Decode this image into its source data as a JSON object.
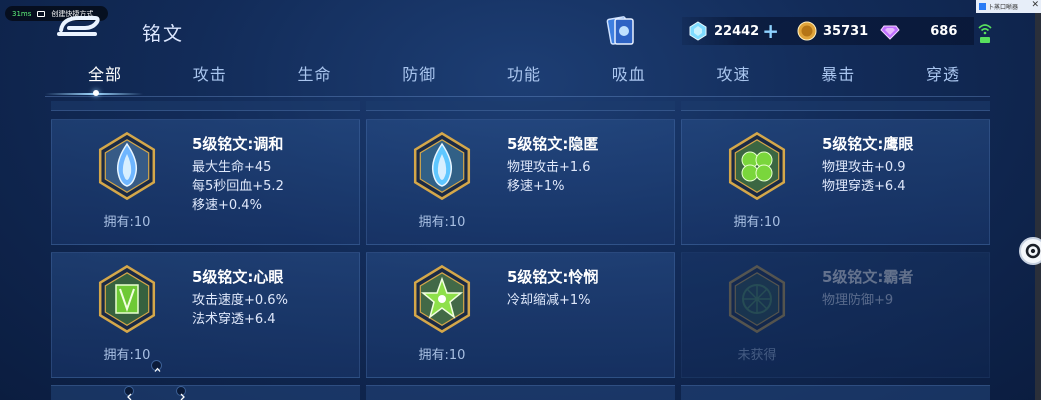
{
  "status": {
    "ping": "31ms",
    "shortcut_label": "创建快捷方式"
  },
  "header": {
    "title": "铭文"
  },
  "currency": [
    {
      "name": "diamond",
      "icon": "diamond-icon",
      "value": "22442",
      "has_plus": true
    },
    {
      "name": "gold",
      "icon": "gold-coin-icon",
      "value": "35731",
      "has_plus": false
    },
    {
      "name": "crystal",
      "icon": "purple-gem-icon",
      "value": "686",
      "has_plus": false
    }
  ],
  "window": {
    "title": "卜蒸口晰器"
  },
  "tabs": [
    "全部",
    "攻击",
    "生命",
    "防御",
    "功能",
    "吸血",
    "攻速",
    "暴击",
    "穿透"
  ],
  "active_tab": 0,
  "cards": [
    {
      "name": "5级铭文:调和",
      "attrs": [
        "最大生命+45",
        "每5秒回血+5.2",
        "移速+0.4%"
      ],
      "owned": "拥有:10",
      "locked": false,
      "emblem": "blue-drop",
      "color": "#6fb6ff"
    },
    {
      "name": "5级铭文:隐匿",
      "attrs": [
        "物理攻击+1.6",
        "移速+1%"
      ],
      "owned": "拥有:10",
      "locked": false,
      "emblem": "blue-flame",
      "color": "#5fc7ff"
    },
    {
      "name": "5级铭文:鹰眼",
      "attrs": [
        "物理攻击+0.9",
        "物理穿透+6.4"
      ],
      "owned": "拥有:10",
      "locked": false,
      "emblem": "green-clover",
      "color": "#7ad63c"
    },
    {
      "name": "5级铭文:心眼",
      "attrs": [
        "攻击速度+0.6%",
        "法术穿透+6.4"
      ],
      "owned": "拥有:10",
      "locked": false,
      "emblem": "green-gate",
      "color": "#6ec935"
    },
    {
      "name": "5级铭文:怜悯",
      "attrs": [
        "冷却缩减+1%"
      ],
      "owned": "拥有:10",
      "locked": false,
      "emblem": "green-star",
      "color": "#8ee04a"
    },
    {
      "name": "5级铭文:霸者",
      "attrs": [
        "物理防御+9"
      ],
      "owned": "未获得",
      "locked": true,
      "emblem": "green-web",
      "color": "#4f8f5a"
    }
  ],
  "colors": {
    "accent": "#9fd8ff",
    "bg": "#122b58",
    "gold_frame": "#d4a74a"
  }
}
